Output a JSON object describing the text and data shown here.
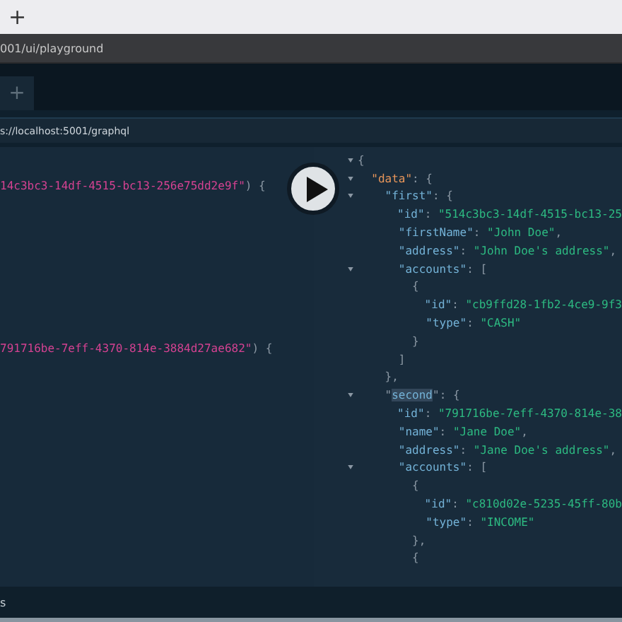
{
  "browser": {
    "new_tab": "+",
    "address": "001/ui/playground"
  },
  "playground": {
    "new_tab": "+",
    "endpoint": "s://localhost:5001/graphql"
  },
  "query": {
    "lines": [
      {
        "tokens": [
          {
            "kind": "string",
            "text": "14c3bc3-14df-4515-bc13-256e75dd2e9f\""
          },
          {
            "kind": "punct",
            "text": ") {"
          }
        ]
      },
      {
        "tokens": [
          {
            "kind": "string",
            "text": "791716be-7eff-4370-814e-3884d27ae682\""
          },
          {
            "kind": "punct",
            "text": ") {"
          }
        ]
      }
    ]
  },
  "result": {
    "lines": [
      {
        "fold": true,
        "tokens": [
          {
            "kind": "punct",
            "text": "{"
          }
        ]
      },
      {
        "fold": true,
        "tokens": [
          {
            "kind": "root-key",
            "text": "  \"data\""
          },
          {
            "kind": "punct",
            "text": ": {"
          }
        ]
      },
      {
        "fold": true,
        "tokens": [
          {
            "kind": "key",
            "text": "    \"first\""
          },
          {
            "kind": "punct",
            "text": ": {"
          }
        ]
      },
      {
        "fold": false,
        "tokens": [
          {
            "kind": "key",
            "text": "      \"id\""
          },
          {
            "kind": "punct",
            "text": ": "
          },
          {
            "kind": "string",
            "text": "\"514c3bc3-14df-4515-bc13-25"
          }
        ]
      },
      {
        "fold": false,
        "tokens": [
          {
            "kind": "key",
            "text": "      \"firstName\""
          },
          {
            "kind": "punct",
            "text": ": "
          },
          {
            "kind": "string",
            "text": "\"John Doe\""
          },
          {
            "kind": "punct",
            "text": ","
          }
        ]
      },
      {
        "fold": false,
        "tokens": [
          {
            "kind": "key",
            "text": "      \"address\""
          },
          {
            "kind": "punct",
            "text": ": "
          },
          {
            "kind": "string",
            "text": "\"John Doe's address\""
          },
          {
            "kind": "punct",
            "text": ","
          }
        ]
      },
      {
        "fold": true,
        "tokens": [
          {
            "kind": "key",
            "text": "      \"accounts\""
          },
          {
            "kind": "punct",
            "text": ": ["
          }
        ]
      },
      {
        "fold": false,
        "tokens": [
          {
            "kind": "punct",
            "text": "        {"
          }
        ]
      },
      {
        "fold": false,
        "tokens": [
          {
            "kind": "key",
            "text": "          \"id\""
          },
          {
            "kind": "punct",
            "text": ": "
          },
          {
            "kind": "string",
            "text": "\"cb9ffd28-1fb2-4ce9-9f3"
          }
        ]
      },
      {
        "fold": false,
        "tokens": [
          {
            "kind": "key",
            "text": "          \"type\""
          },
          {
            "kind": "punct",
            "text": ": "
          },
          {
            "kind": "string",
            "text": "\"CASH\""
          }
        ]
      },
      {
        "fold": false,
        "tokens": [
          {
            "kind": "punct",
            "text": "        }"
          }
        ]
      },
      {
        "fold": false,
        "tokens": [
          {
            "kind": "punct",
            "text": "      ]"
          }
        ]
      },
      {
        "fold": false,
        "tokens": [
          {
            "kind": "punct",
            "text": "    },"
          }
        ]
      },
      {
        "fold": true,
        "tokens": [
          {
            "kind": "punct",
            "text": "    \""
          },
          {
            "kind": "highlight-key",
            "text": "second"
          },
          {
            "kind": "punct",
            "text": "\": {"
          }
        ]
      },
      {
        "fold": false,
        "tokens": [
          {
            "kind": "key",
            "text": "      \"id\""
          },
          {
            "kind": "punct",
            "text": ": "
          },
          {
            "kind": "string",
            "text": "\"791716be-7eff-4370-814e-38"
          }
        ]
      },
      {
        "fold": false,
        "tokens": [
          {
            "kind": "key",
            "text": "      \"name\""
          },
          {
            "kind": "punct",
            "text": ": "
          },
          {
            "kind": "string",
            "text": "\"Jane Doe\""
          },
          {
            "kind": "punct",
            "text": ","
          }
        ]
      },
      {
        "fold": false,
        "tokens": [
          {
            "kind": "key",
            "text": "      \"address\""
          },
          {
            "kind": "punct",
            "text": ": "
          },
          {
            "kind": "string",
            "text": "\"Jane Doe's address\""
          },
          {
            "kind": "punct",
            "text": ","
          }
        ]
      },
      {
        "fold": true,
        "tokens": [
          {
            "kind": "key",
            "text": "      \"accounts\""
          },
          {
            "kind": "punct",
            "text": ": ["
          }
        ]
      },
      {
        "fold": false,
        "tokens": [
          {
            "kind": "punct",
            "text": "        {"
          }
        ]
      },
      {
        "fold": false,
        "tokens": [
          {
            "kind": "key",
            "text": "          \"id\""
          },
          {
            "kind": "punct",
            "text": ": "
          },
          {
            "kind": "string",
            "text": "\"c810d02e-5235-45ff-80b"
          }
        ]
      },
      {
        "fold": false,
        "tokens": [
          {
            "kind": "key",
            "text": "          \"type\""
          },
          {
            "kind": "punct",
            "text": ": "
          },
          {
            "kind": "string",
            "text": "\"INCOME\""
          }
        ]
      },
      {
        "fold": false,
        "tokens": [
          {
            "kind": "punct",
            "text": "        },"
          }
        ]
      },
      {
        "fold": false,
        "tokens": [
          {
            "kind": "punct",
            "text": "        {"
          }
        ]
      }
    ]
  },
  "bottom_bar": {
    "label": "s"
  }
}
